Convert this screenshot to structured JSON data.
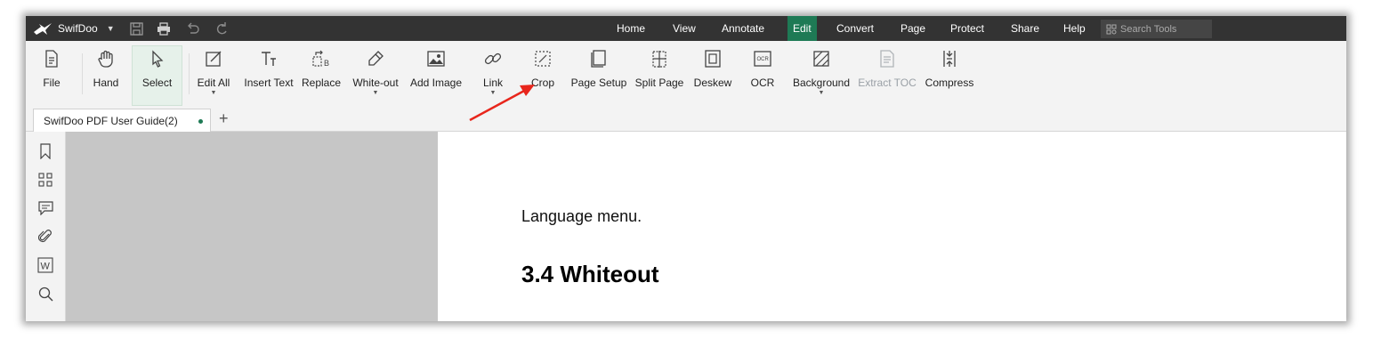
{
  "app": {
    "name": "SwifDoo"
  },
  "menus": [
    {
      "label": "Home",
      "active": false
    },
    {
      "label": "View",
      "active": false
    },
    {
      "label": "Annotate",
      "active": false
    },
    {
      "label": "Edit",
      "active": true
    },
    {
      "label": "Convert",
      "active": false
    },
    {
      "label": "Page",
      "active": false
    },
    {
      "label": "Protect",
      "active": false
    },
    {
      "label": "Share",
      "active": false
    },
    {
      "label": "Help",
      "active": false
    }
  ],
  "search": {
    "placeholder": "Search Tools",
    "icon": "search-tools-icon"
  },
  "ribbon": {
    "tools": [
      {
        "label": "File",
        "icon": "file-icon"
      },
      {
        "label": "Hand",
        "icon": "hand-icon"
      },
      {
        "label": "Select",
        "icon": "cursor-icon",
        "selected": true
      },
      {
        "label": "Edit All",
        "icon": "edit-all-icon",
        "dropdown": true
      },
      {
        "label": "Insert Text",
        "icon": "insert-text-icon"
      },
      {
        "label": "Replace",
        "icon": "replace-icon"
      },
      {
        "label": "White-out",
        "icon": "eraser-icon",
        "dropdown": true
      },
      {
        "label": "Add Image",
        "icon": "image-icon"
      },
      {
        "label": "Link",
        "icon": "link-icon",
        "dropdown": true
      },
      {
        "label": "Crop",
        "icon": "crop-icon"
      },
      {
        "label": "Page Setup",
        "icon": "page-setup-icon"
      },
      {
        "label": "Split Page",
        "icon": "split-page-icon"
      },
      {
        "label": "Deskew",
        "icon": "deskew-icon"
      },
      {
        "label": "OCR",
        "icon": "ocr-icon",
        "icon_text": "OCR"
      },
      {
        "label": "Background",
        "icon": "background-icon",
        "dropdown": true
      },
      {
        "label": "Extract TOC",
        "icon": "extract-toc-icon",
        "disabled": true
      },
      {
        "label": "Compress",
        "icon": "compress-icon"
      }
    ]
  },
  "tab": {
    "title": "SwifDoo PDF User Guide(2)",
    "add": "+"
  },
  "sidebar": {
    "icons": [
      "bookmark-icon",
      "thumbnails-icon",
      "comment-icon",
      "attachment-icon",
      "word-icon",
      "search-icon"
    ],
    "word_letter": "W"
  },
  "document": {
    "text": "Language menu.",
    "heading": "3.4 Whiteout"
  },
  "annotation": {
    "arrow_color": "#e8261c",
    "points_to": "Crop"
  },
  "colors": {
    "topbar": "#333333",
    "accent": "#1e7a55",
    "ribbon": "#f3f3f3",
    "canvas": "#c6c6c6"
  }
}
